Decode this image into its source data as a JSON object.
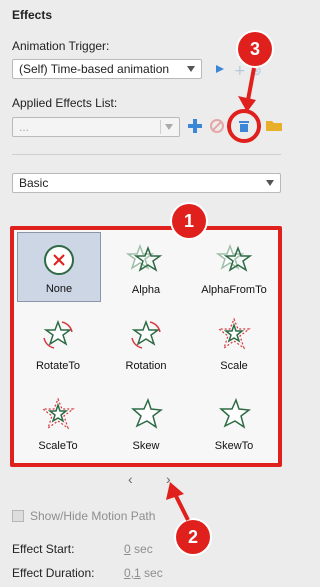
{
  "panel_title": "Effects",
  "trigger": {
    "label": "Animation Trigger:",
    "value": "(Self) Time-based animation"
  },
  "applied": {
    "label": "Applied Effects List:",
    "placeholder": "..."
  },
  "category": {
    "value": "Basic"
  },
  "effects": [
    {
      "label": "None",
      "icon": "none-icon",
      "selected": true
    },
    {
      "label": "Alpha",
      "icon": "alpha-star-icon"
    },
    {
      "label": "AlphaFromTo",
      "icon": "alpha-from-to-star-icon"
    },
    {
      "label": "RotateTo",
      "icon": "rotate-to-star-icon"
    },
    {
      "label": "Rotation",
      "icon": "rotation-star-icon"
    },
    {
      "label": "Scale",
      "icon": "scale-star-icon"
    },
    {
      "label": "ScaleTo",
      "icon": "scale-to-star-icon"
    },
    {
      "label": "Skew",
      "icon": "skew-star-icon"
    },
    {
      "label": "SkewTo",
      "icon": "skew-to-star-icon"
    }
  ],
  "pager": {
    "prev": "‹",
    "next": "›"
  },
  "motion_path": {
    "label": "Show/Hide Motion Path"
  },
  "effect_start": {
    "label": "Effect Start:",
    "value": "0",
    "unit": "sec"
  },
  "effect_duration": {
    "label": "Effect Duration:",
    "value": "0,1",
    "unit": "sec"
  },
  "annotations": {
    "badge1": "1",
    "badge2": "2",
    "badge3": "3"
  },
  "colors": {
    "accent_red": "#e0201c",
    "star_green": "#2e6b45",
    "dotted_red": "#d9363e",
    "add_blue": "#3b86d6",
    "folder_yellow": "#e8b02a"
  }
}
